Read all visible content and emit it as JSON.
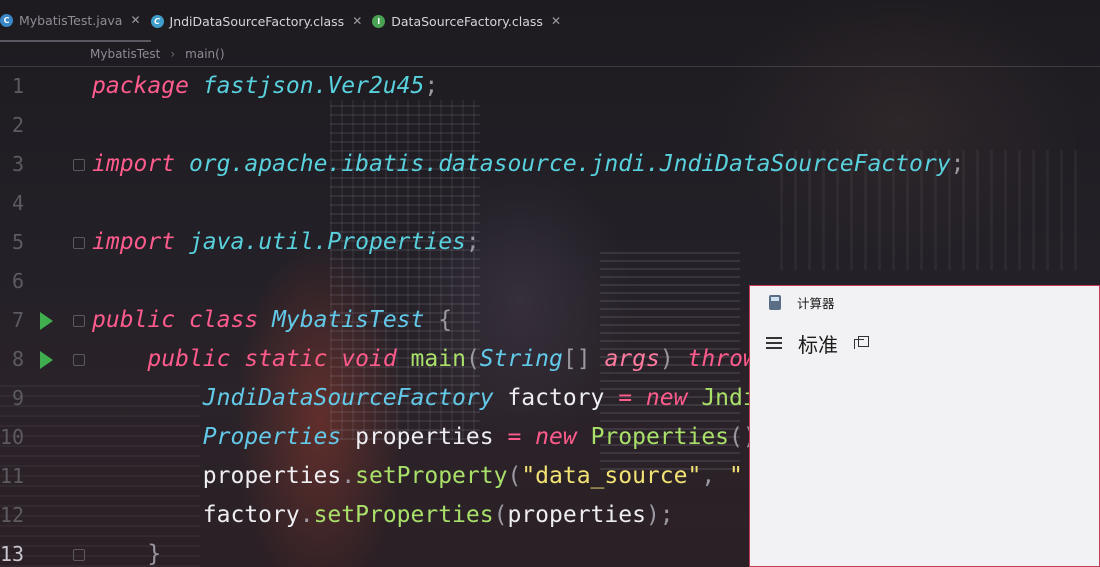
{
  "tabs": [
    {
      "label": "MybatisTest.java",
      "icon": "java-class-icon",
      "active": true
    },
    {
      "label": "JndiDataSourceFactory.class",
      "icon": "class-file-icon",
      "active": false
    },
    {
      "label": "DataSourceFactory.class",
      "icon": "interface-file-icon",
      "active": false
    }
  ],
  "breadcrumb": [
    "MybatisTest",
    "main()"
  ],
  "editor": {
    "current_line": 13,
    "line_numbers": [
      "1",
      "2",
      "3",
      "4",
      "5",
      "6",
      "7",
      "8",
      "9",
      "10",
      "11",
      "12",
      "13"
    ],
    "lines": [
      [
        {
          "t": "package",
          "c": "kw"
        },
        {
          "t": " ",
          "c": "plain"
        },
        {
          "t": "fastjson.Ver2u45",
          "c": "pkg"
        },
        {
          "t": ";",
          "c": "punc"
        }
      ],
      [],
      [
        {
          "t": "import",
          "c": "kw"
        },
        {
          "t": " ",
          "c": "plain"
        },
        {
          "t": "org.apache.ibatis.datasource.jndi.JndiDataSourceFactory",
          "c": "pkg"
        },
        {
          "t": ";",
          "c": "punc"
        }
      ],
      [],
      [
        {
          "t": "import",
          "c": "kw"
        },
        {
          "t": " ",
          "c": "plain"
        },
        {
          "t": "java.util.Properties",
          "c": "pkg"
        },
        {
          "t": ";",
          "c": "punc"
        }
      ],
      [],
      [
        {
          "t": "public",
          "c": "kw"
        },
        {
          "t": " ",
          "c": "plain"
        },
        {
          "t": "class",
          "c": "kw"
        },
        {
          "t": " ",
          "c": "plain"
        },
        {
          "t": "MybatisTest",
          "c": "cls"
        },
        {
          "t": " {",
          "c": "punc"
        }
      ],
      [
        {
          "t": "    ",
          "c": "plain"
        },
        {
          "t": "public",
          "c": "kw"
        },
        {
          "t": " ",
          "c": "plain"
        },
        {
          "t": "static",
          "c": "kw"
        },
        {
          "t": " ",
          "c": "plain"
        },
        {
          "t": "void",
          "c": "kw"
        },
        {
          "t": " ",
          "c": "plain"
        },
        {
          "t": "main",
          "c": "fn"
        },
        {
          "t": "(",
          "c": "punc"
        },
        {
          "t": "String",
          "c": "cls"
        },
        {
          "t": "[] ",
          "c": "punc"
        },
        {
          "t": "args",
          "c": "par"
        },
        {
          "t": ") ",
          "c": "punc"
        },
        {
          "t": "throws",
          "c": "kw"
        }
      ],
      [
        {
          "t": "        ",
          "c": "plain"
        },
        {
          "t": "JndiDataSourceFactory",
          "c": "cls"
        },
        {
          "t": " factory ",
          "c": "plain"
        },
        {
          "t": "=",
          "c": "op"
        },
        {
          "t": " ",
          "c": "plain"
        },
        {
          "t": "new",
          "c": "kw"
        },
        {
          "t": " ",
          "c": "plain"
        },
        {
          "t": "JndiDataSourceFactory",
          "c": "fn"
        }
      ],
      [
        {
          "t": "        ",
          "c": "plain"
        },
        {
          "t": "Properties",
          "c": "cls"
        },
        {
          "t": " properties ",
          "c": "plain"
        },
        {
          "t": "=",
          "c": "op"
        },
        {
          "t": " ",
          "c": "plain"
        },
        {
          "t": "new",
          "c": "kw"
        },
        {
          "t": " ",
          "c": "plain"
        },
        {
          "t": "Properties",
          "c": "fn"
        },
        {
          "t": "();",
          "c": "punc"
        }
      ],
      [
        {
          "t": "        ",
          "c": "plain"
        },
        {
          "t": "properties",
          "c": "plain"
        },
        {
          "t": ".",
          "c": "punc"
        },
        {
          "t": "setProperty",
          "c": "fn"
        },
        {
          "t": "(",
          "c": "punc"
        },
        {
          "t": "\"data_source\"",
          "c": "str"
        },
        {
          "t": ", ",
          "c": "punc"
        },
        {
          "t": "\"",
          "c": "str"
        }
      ],
      [
        {
          "t": "        ",
          "c": "plain"
        },
        {
          "t": "factory",
          "c": "plain"
        },
        {
          "t": ".",
          "c": "punc"
        },
        {
          "t": "setProperties",
          "c": "fn"
        },
        {
          "t": "(",
          "c": "punc"
        },
        {
          "t": "properties",
          "c": "plain"
        },
        {
          "t": ");",
          "c": "punc"
        }
      ],
      [
        {
          "t": "    ",
          "c": "plain"
        },
        {
          "t": "}",
          "c": "punc"
        }
      ]
    ],
    "run_gutter_lines": [
      7,
      8
    ],
    "fold_lines": [
      3,
      5,
      7,
      8,
      13
    ]
  },
  "calculator": {
    "title": "计算器",
    "mode": "标准",
    "icons": {
      "app": "calculator-app-icon",
      "menu": "hamburger-menu-icon",
      "keep_on_top": "keep-on-top-icon"
    }
  },
  "colors": {
    "keyword": "#ff5b8c",
    "package": "#58d1dd",
    "class": "#63c9e8",
    "method": "#a8e06a",
    "string": "#f2e274",
    "run_gutter": "#3fae4f",
    "calc_border": "#c83a5a"
  }
}
